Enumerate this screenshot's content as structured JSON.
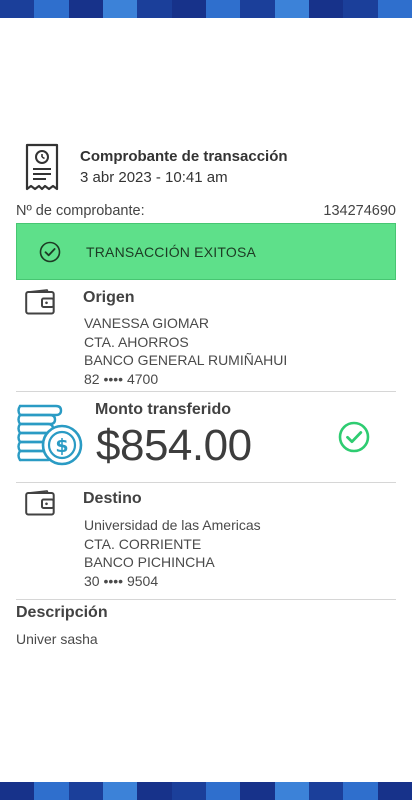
{
  "receipt": {
    "title": "Comprobante de transacción",
    "date": "3 abr 2023 - 10:41 am",
    "number_label": "Nº de comprobante:",
    "number_value": "134274690"
  },
  "status": {
    "text": "TRANSACCIÓN EXITOSA",
    "color": "#5ee08a"
  },
  "origin": {
    "title": "Origen",
    "name": "VANESSA GIOMAR",
    "account_type": "CTA. AHORROS",
    "bank": "BANCO GENERAL RUMIÑAHUI",
    "account": "82 •••• 4700"
  },
  "amount": {
    "title": "Monto transferido",
    "value": "$854.00"
  },
  "destination": {
    "title": "Destino",
    "name": "Universidad de las Americas",
    "account_type": "CTA. CORRIENTE",
    "bank": "BANCO PICHINCHA",
    "account": "30 •••• 9504"
  },
  "description": {
    "title": "Descripción",
    "text": "Univer sasha"
  },
  "icons": {
    "receipt": "receipt-icon",
    "status": "check-circle-icon",
    "origin": "wallet-icon",
    "amount": "coins-dollar-icon",
    "amount_status": "check-circle-icon",
    "destination": "wallet-icon"
  },
  "colors": {
    "brand_blue": "#1b3f9a",
    "success_green": "#2ecc71",
    "coins_teal": "#2a9bc4"
  }
}
